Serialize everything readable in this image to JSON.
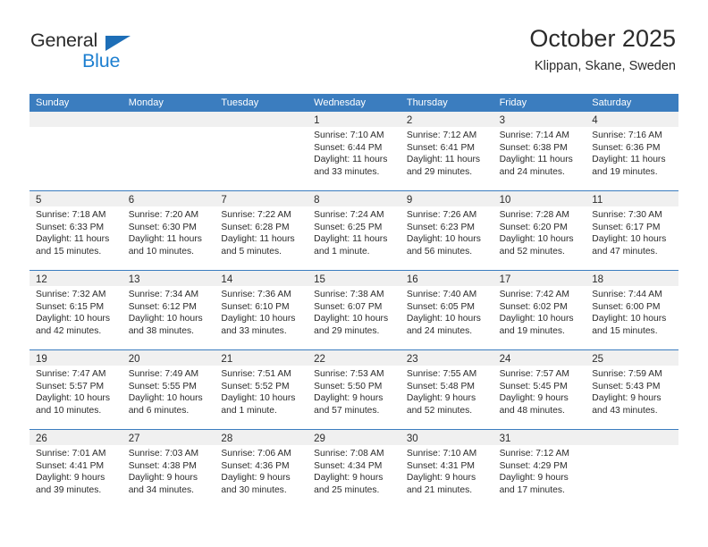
{
  "brand": {
    "name_top": "General",
    "name_bottom": "Blue",
    "triangle_color": "#1d6eb7",
    "blue_color": "#1d7fd0"
  },
  "header": {
    "title": "October 2025",
    "subtitle": "Klippan, Skane, Sweden"
  },
  "theme": {
    "header_band": "#3b7dbf",
    "daynum_band": "#f0f0f0",
    "text": "#2b2b2b"
  },
  "weekdays": [
    "Sunday",
    "Monday",
    "Tuesday",
    "Wednesday",
    "Thursday",
    "Friday",
    "Saturday"
  ],
  "weeks": [
    [
      {
        "day": "",
        "empty": true
      },
      {
        "day": "",
        "empty": true
      },
      {
        "day": "",
        "empty": true
      },
      {
        "day": "1",
        "sunrise": "Sunrise: 7:10 AM",
        "sunset": "Sunset: 6:44 PM",
        "daylight1": "Daylight: 11 hours",
        "daylight2": "and 33 minutes."
      },
      {
        "day": "2",
        "sunrise": "Sunrise: 7:12 AM",
        "sunset": "Sunset: 6:41 PM",
        "daylight1": "Daylight: 11 hours",
        "daylight2": "and 29 minutes."
      },
      {
        "day": "3",
        "sunrise": "Sunrise: 7:14 AM",
        "sunset": "Sunset: 6:38 PM",
        "daylight1": "Daylight: 11 hours",
        "daylight2": "and 24 minutes."
      },
      {
        "day": "4",
        "sunrise": "Sunrise: 7:16 AM",
        "sunset": "Sunset: 6:36 PM",
        "daylight1": "Daylight: 11 hours",
        "daylight2": "and 19 minutes."
      }
    ],
    [
      {
        "day": "5",
        "sunrise": "Sunrise: 7:18 AM",
        "sunset": "Sunset: 6:33 PM",
        "daylight1": "Daylight: 11 hours",
        "daylight2": "and 15 minutes."
      },
      {
        "day": "6",
        "sunrise": "Sunrise: 7:20 AM",
        "sunset": "Sunset: 6:30 PM",
        "daylight1": "Daylight: 11 hours",
        "daylight2": "and 10 minutes."
      },
      {
        "day": "7",
        "sunrise": "Sunrise: 7:22 AM",
        "sunset": "Sunset: 6:28 PM",
        "daylight1": "Daylight: 11 hours",
        "daylight2": "and 5 minutes."
      },
      {
        "day": "8",
        "sunrise": "Sunrise: 7:24 AM",
        "sunset": "Sunset: 6:25 PM",
        "daylight1": "Daylight: 11 hours",
        "daylight2": "and 1 minute."
      },
      {
        "day": "9",
        "sunrise": "Sunrise: 7:26 AM",
        "sunset": "Sunset: 6:23 PM",
        "daylight1": "Daylight: 10 hours",
        "daylight2": "and 56 minutes."
      },
      {
        "day": "10",
        "sunrise": "Sunrise: 7:28 AM",
        "sunset": "Sunset: 6:20 PM",
        "daylight1": "Daylight: 10 hours",
        "daylight2": "and 52 minutes."
      },
      {
        "day": "11",
        "sunrise": "Sunrise: 7:30 AM",
        "sunset": "Sunset: 6:17 PM",
        "daylight1": "Daylight: 10 hours",
        "daylight2": "and 47 minutes."
      }
    ],
    [
      {
        "day": "12",
        "sunrise": "Sunrise: 7:32 AM",
        "sunset": "Sunset: 6:15 PM",
        "daylight1": "Daylight: 10 hours",
        "daylight2": "and 42 minutes."
      },
      {
        "day": "13",
        "sunrise": "Sunrise: 7:34 AM",
        "sunset": "Sunset: 6:12 PM",
        "daylight1": "Daylight: 10 hours",
        "daylight2": "and 38 minutes."
      },
      {
        "day": "14",
        "sunrise": "Sunrise: 7:36 AM",
        "sunset": "Sunset: 6:10 PM",
        "daylight1": "Daylight: 10 hours",
        "daylight2": "and 33 minutes."
      },
      {
        "day": "15",
        "sunrise": "Sunrise: 7:38 AM",
        "sunset": "Sunset: 6:07 PM",
        "daylight1": "Daylight: 10 hours",
        "daylight2": "and 29 minutes."
      },
      {
        "day": "16",
        "sunrise": "Sunrise: 7:40 AM",
        "sunset": "Sunset: 6:05 PM",
        "daylight1": "Daylight: 10 hours",
        "daylight2": "and 24 minutes."
      },
      {
        "day": "17",
        "sunrise": "Sunrise: 7:42 AM",
        "sunset": "Sunset: 6:02 PM",
        "daylight1": "Daylight: 10 hours",
        "daylight2": "and 19 minutes."
      },
      {
        "day": "18",
        "sunrise": "Sunrise: 7:44 AM",
        "sunset": "Sunset: 6:00 PM",
        "daylight1": "Daylight: 10 hours",
        "daylight2": "and 15 minutes."
      }
    ],
    [
      {
        "day": "19",
        "sunrise": "Sunrise: 7:47 AM",
        "sunset": "Sunset: 5:57 PM",
        "daylight1": "Daylight: 10 hours",
        "daylight2": "and 10 minutes."
      },
      {
        "day": "20",
        "sunrise": "Sunrise: 7:49 AM",
        "sunset": "Sunset: 5:55 PM",
        "daylight1": "Daylight: 10 hours",
        "daylight2": "and 6 minutes."
      },
      {
        "day": "21",
        "sunrise": "Sunrise: 7:51 AM",
        "sunset": "Sunset: 5:52 PM",
        "daylight1": "Daylight: 10 hours",
        "daylight2": "and 1 minute."
      },
      {
        "day": "22",
        "sunrise": "Sunrise: 7:53 AM",
        "sunset": "Sunset: 5:50 PM",
        "daylight1": "Daylight: 9 hours",
        "daylight2": "and 57 minutes."
      },
      {
        "day": "23",
        "sunrise": "Sunrise: 7:55 AM",
        "sunset": "Sunset: 5:48 PM",
        "daylight1": "Daylight: 9 hours",
        "daylight2": "and 52 minutes."
      },
      {
        "day": "24",
        "sunrise": "Sunrise: 7:57 AM",
        "sunset": "Sunset: 5:45 PM",
        "daylight1": "Daylight: 9 hours",
        "daylight2": "and 48 minutes."
      },
      {
        "day": "25",
        "sunrise": "Sunrise: 7:59 AM",
        "sunset": "Sunset: 5:43 PM",
        "daylight1": "Daylight: 9 hours",
        "daylight2": "and 43 minutes."
      }
    ],
    [
      {
        "day": "26",
        "sunrise": "Sunrise: 7:01 AM",
        "sunset": "Sunset: 4:41 PM",
        "daylight1": "Daylight: 9 hours",
        "daylight2": "and 39 minutes."
      },
      {
        "day": "27",
        "sunrise": "Sunrise: 7:03 AM",
        "sunset": "Sunset: 4:38 PM",
        "daylight1": "Daylight: 9 hours",
        "daylight2": "and 34 minutes."
      },
      {
        "day": "28",
        "sunrise": "Sunrise: 7:06 AM",
        "sunset": "Sunset: 4:36 PM",
        "daylight1": "Daylight: 9 hours",
        "daylight2": "and 30 minutes."
      },
      {
        "day": "29",
        "sunrise": "Sunrise: 7:08 AM",
        "sunset": "Sunset: 4:34 PM",
        "daylight1": "Daylight: 9 hours",
        "daylight2": "and 25 minutes."
      },
      {
        "day": "30",
        "sunrise": "Sunrise: 7:10 AM",
        "sunset": "Sunset: 4:31 PM",
        "daylight1": "Daylight: 9 hours",
        "daylight2": "and 21 minutes."
      },
      {
        "day": "31",
        "sunrise": "Sunrise: 7:12 AM",
        "sunset": "Sunset: 4:29 PM",
        "daylight1": "Daylight: 9 hours",
        "daylight2": "and 17 minutes."
      },
      {
        "day": "",
        "empty": true
      }
    ]
  ]
}
